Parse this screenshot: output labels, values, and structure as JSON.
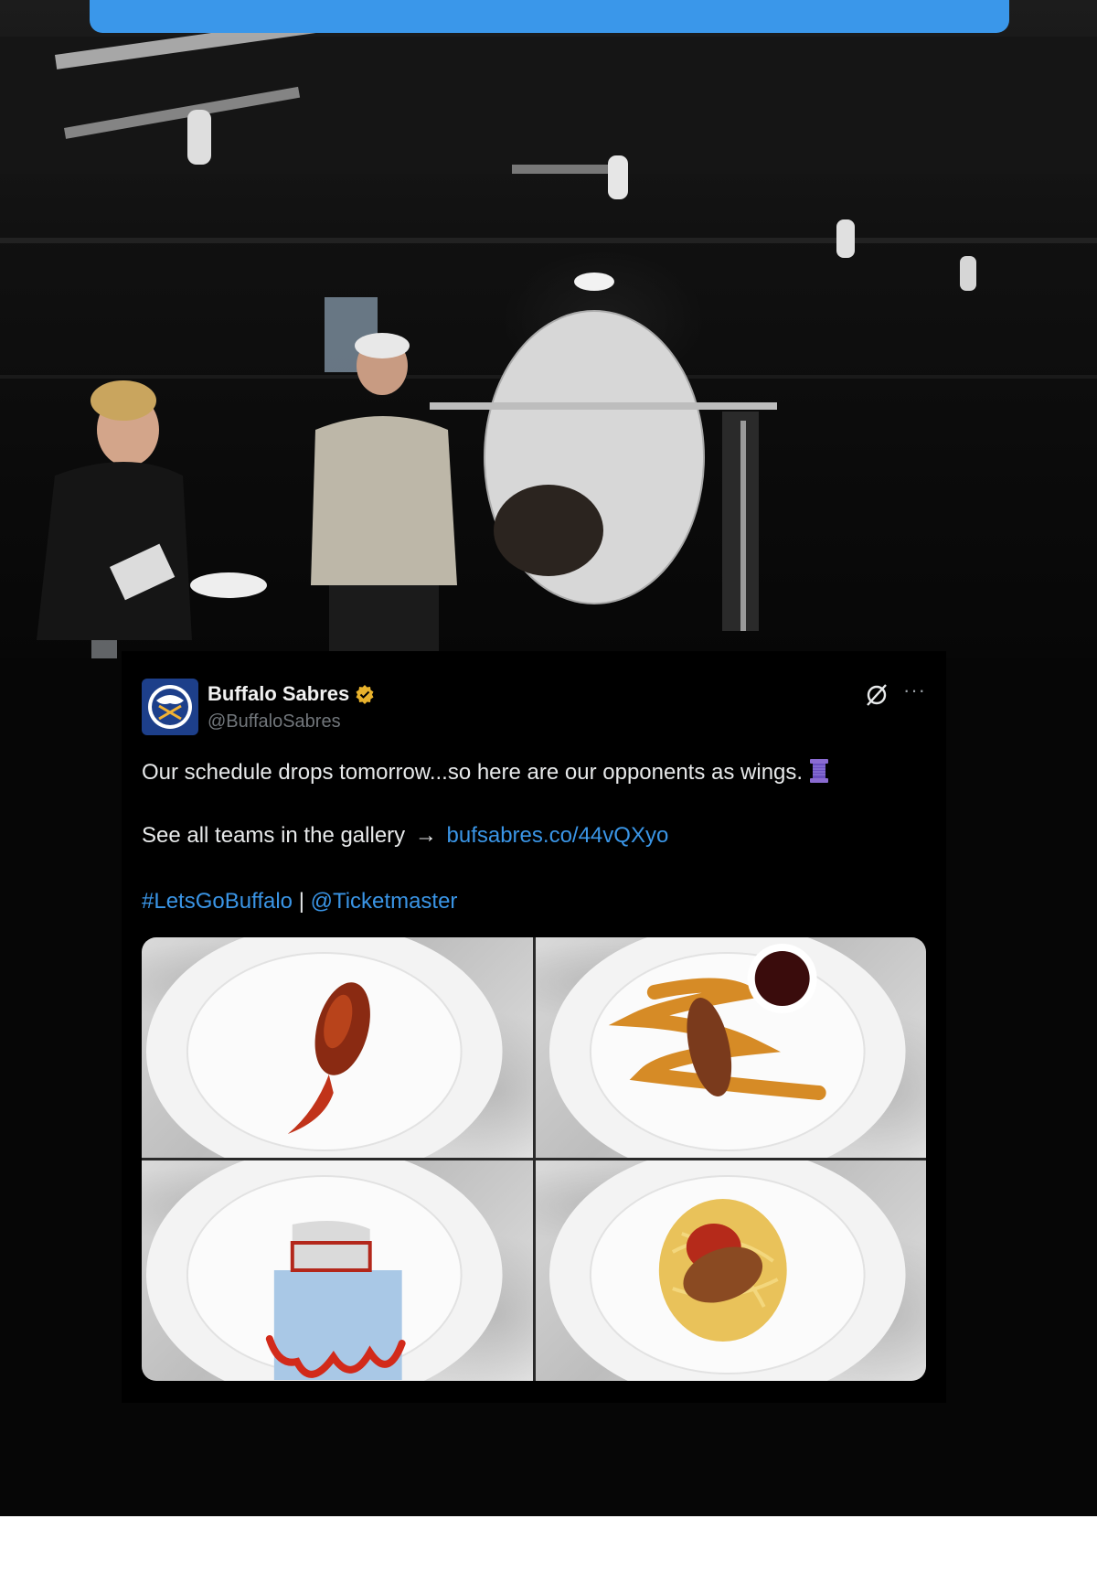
{
  "tweet": {
    "display_name": "Buffalo Sabres",
    "handle": "@BuffaloSabres",
    "text_line1": "Our schedule drops tomorrow...so here are our opponents as wings.",
    "text_line2_prefix": "See all teams in the gallery",
    "text_line2_arrow": "→",
    "link_url": "bufsabres.co/44vQXyo",
    "hashtag": "#LetsGoBuffalo",
    "separator": "|",
    "mention": "@Ticketmaster",
    "more_glyph": "···",
    "media": [
      {
        "icon": "wing-bbq-glaze-plate"
      },
      {
        "icon": "wing-with-sauce-dip-plate"
      },
      {
        "icon": "ice-rink-net-plate"
      },
      {
        "icon": "wing-on-spaghetti-plate"
      }
    ]
  },
  "colors": {
    "banner_blue": "#3a97ea",
    "link_blue": "#3a95e6",
    "verified_gold": "#e8b22c",
    "sabres_navy": "#1d3f8a"
  }
}
